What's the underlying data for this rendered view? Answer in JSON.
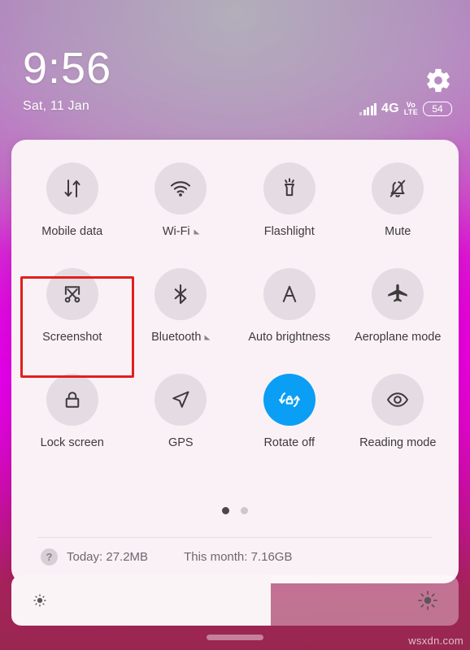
{
  "status": {
    "clock": "9:56",
    "date": "Sat, 11 Jan",
    "network_type": "4G",
    "volte_top": "Vo",
    "volte_bottom": "LTE",
    "battery_level": "54",
    "settings_icon": "gear-icon",
    "signal_icon": "signal-bars-icon"
  },
  "quick_settings": {
    "tiles": [
      [
        {
          "label": "Mobile data",
          "icon": "mobile-data-icon",
          "active": false,
          "expandable": false
        },
        {
          "label": "Wi-Fi",
          "icon": "wifi-icon",
          "active": false,
          "expandable": true
        },
        {
          "label": "Flashlight",
          "icon": "flashlight-icon",
          "active": false,
          "expandable": false
        },
        {
          "label": "Mute",
          "icon": "bell-muted-icon",
          "active": false,
          "expandable": false
        }
      ],
      [
        {
          "label": "Screenshot",
          "icon": "scissors-screenshot-icon",
          "active": false,
          "expandable": false
        },
        {
          "label": "Bluetooth",
          "icon": "bluetooth-icon",
          "active": false,
          "expandable": true
        },
        {
          "label": "Auto brightness",
          "icon": "auto-brightness-a-icon",
          "active": false,
          "expandable": false
        },
        {
          "label": "Aeroplane mode",
          "icon": "airplane-icon",
          "active": false,
          "expandable": false
        }
      ],
      [
        {
          "label": "Lock screen",
          "icon": "padlock-icon",
          "active": false,
          "expandable": false
        },
        {
          "label": "GPS",
          "icon": "navigation-arrow-icon",
          "active": false,
          "expandable": false
        },
        {
          "label": "Rotate off",
          "icon": "rotation-lock-icon",
          "active": true,
          "expandable": false
        },
        {
          "label": "Reading mode",
          "icon": "eye-icon",
          "active": false,
          "expandable": false
        }
      ]
    ],
    "pages": {
      "count": 2,
      "current": 1
    },
    "data_usage": {
      "help_icon_label": "?",
      "today_label": "Today: 27.2MB",
      "month_label": "This month: 7.16GB"
    }
  },
  "brightness": {
    "value_percent": 58,
    "low_icon": "sun-small-icon",
    "high_icon": "sun-large-icon"
  },
  "nav": {
    "handle": "home-handle"
  },
  "watermark": {
    "text": "wsxdn.com"
  },
  "colors": {
    "accent_active": "#0a9ef5",
    "highlight_box": "#e01f1f",
    "panel_bg": "#faf1f6",
    "tile_circle": "#e5dbe2",
    "label_text": "#3d3a3c"
  }
}
